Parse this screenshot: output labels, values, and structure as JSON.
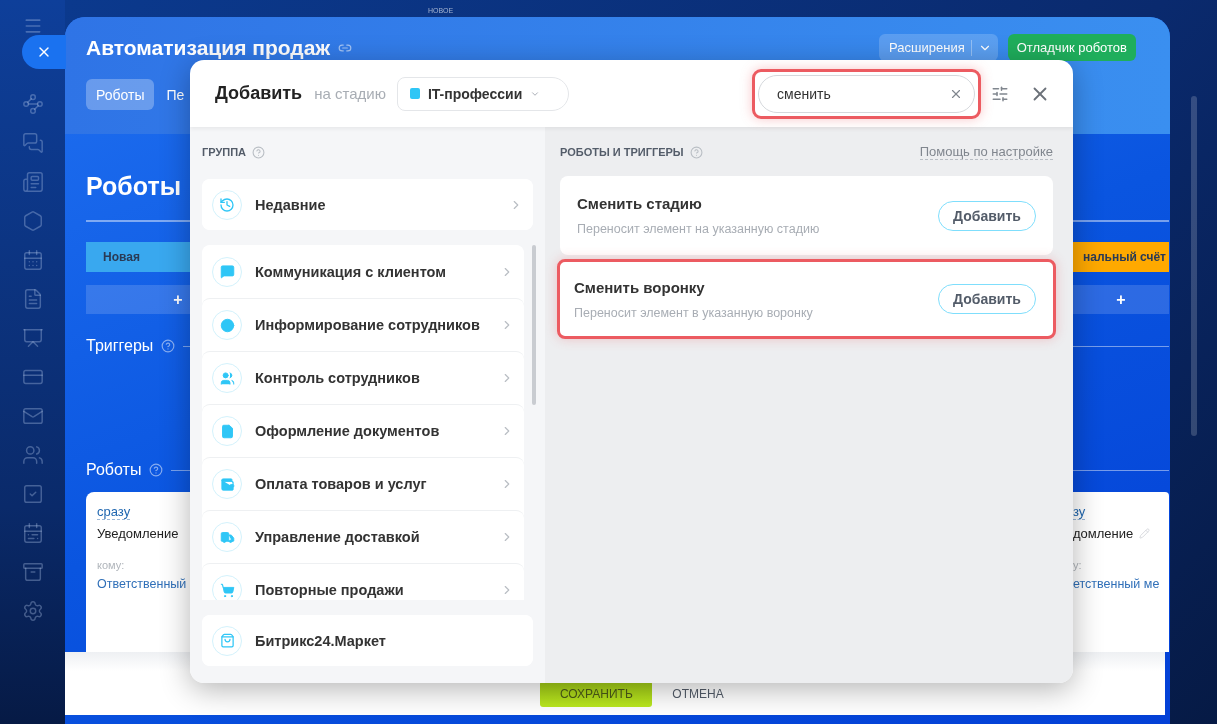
{
  "background_page": {
    "top_label": "НОВОЕ",
    "title": "Автоматизация продаж",
    "extensions_button": "Расширения",
    "debugger_button": "Отладчик роботов",
    "tabs": [
      {
        "label": "Роботы",
        "selected": true
      },
      {
        "label": "Пе",
        "selected": false
      }
    ],
    "section_title": "Роботы",
    "triggers_label": "Триггеры",
    "robots_label": "Роботы",
    "columns": [
      {
        "stage": "Новая",
        "color": "#39a8ef",
        "add": "+",
        "robot": {
          "delay": "сразу",
          "name": "Уведомление",
          "to_label": "кому:",
          "to_value": "Ответственный"
        }
      },
      {
        "stage": "нальный счёт",
        "color": "#ffa900",
        "add": "+",
        "robot": {
          "delay": "зу",
          "name": "домление",
          "to_label": "у:",
          "to_value": "етственный ме"
        }
      }
    ]
  },
  "footer": {
    "save": "СОХРАНИТЬ",
    "cancel": "ОТМЕНА"
  },
  "dialog": {
    "title": "Добавить",
    "stage_label": "на стадию",
    "stage": "IT-профессии",
    "search": {
      "value": "сменить",
      "highlighted": true
    },
    "groups_title": "ГРУППА",
    "recent": {
      "label": "Недавние"
    },
    "groups": [
      {
        "label": "Коммуникация с клиентом"
      },
      {
        "label": "Информирование сотрудников"
      },
      {
        "label": "Контроль сотрудников"
      },
      {
        "label": "Оформление документов"
      },
      {
        "label": "Оплата товаров и услуг"
      },
      {
        "label": "Управление доставкой"
      },
      {
        "label": "Повторные продажи"
      }
    ],
    "market": {
      "label": "Битрикс24.Маркет"
    },
    "results_title": "РОБОТЫ И ТРИГГЕРЫ",
    "help_link": "Помощь по настройке",
    "results": [
      {
        "title": "Сменить стадию",
        "description": "Переносит элемент на указанную стадию",
        "button": "Добавить",
        "highlighted": false
      },
      {
        "title": "Сменить воронку",
        "description": "Переносит элемент в указанную воронку",
        "button": "Добавить",
        "highlighted": true
      }
    ]
  }
}
